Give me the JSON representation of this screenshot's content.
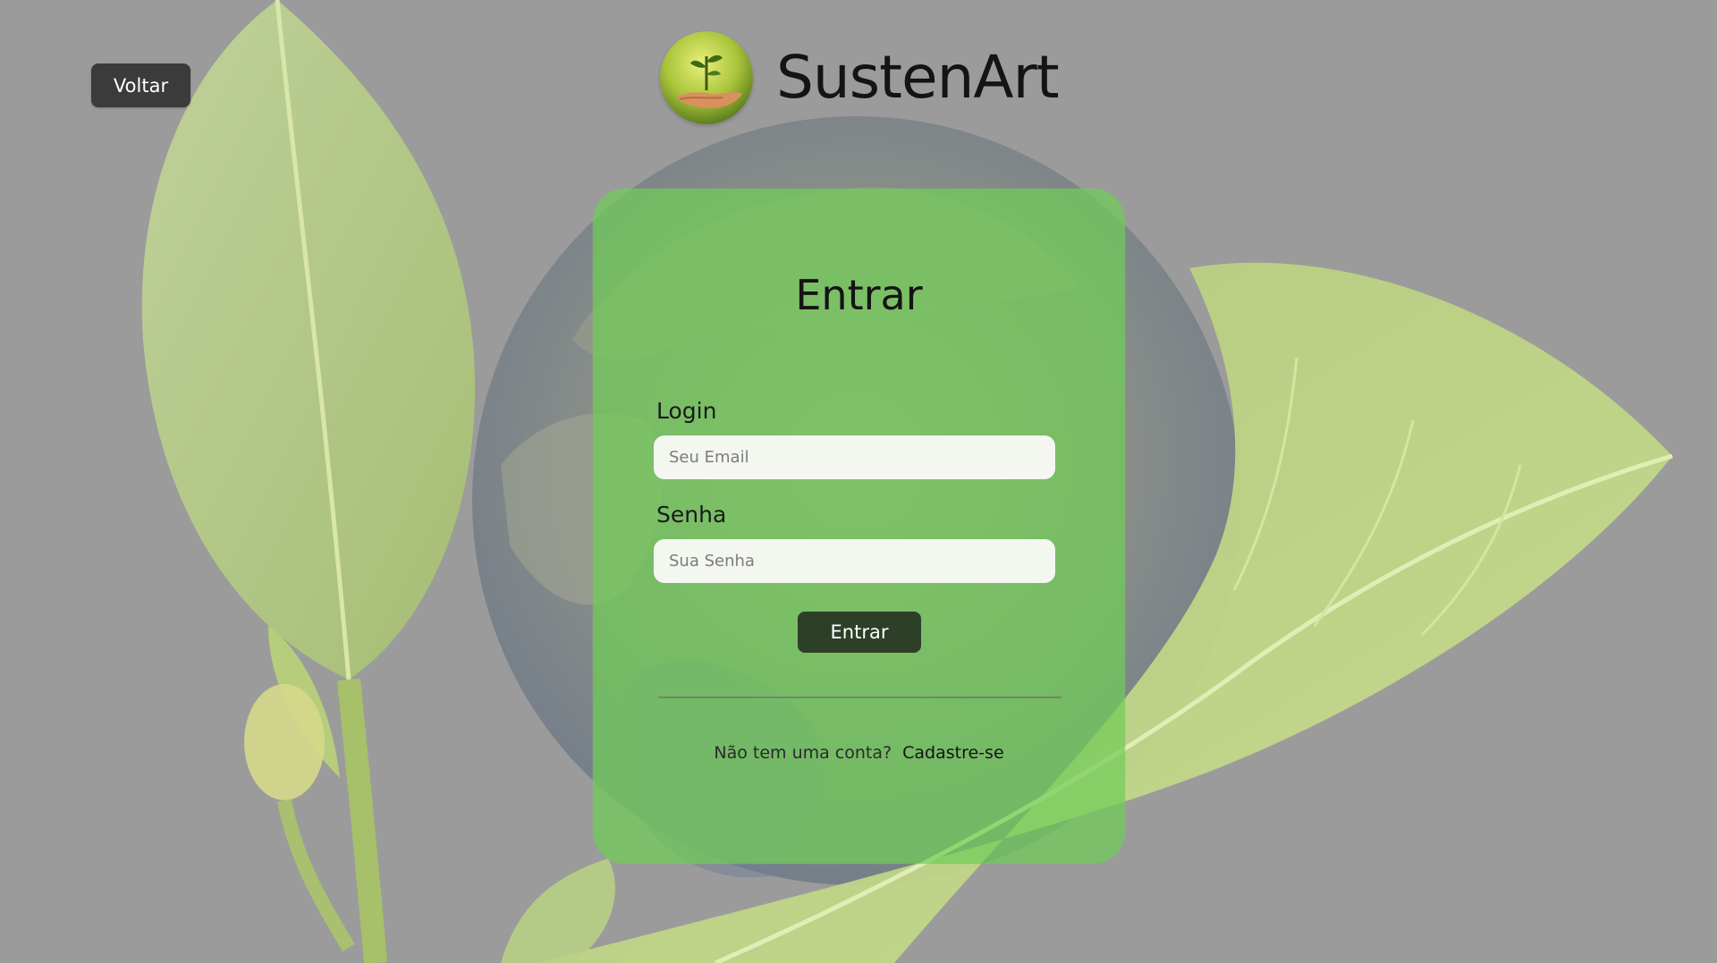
{
  "header": {
    "back_label": "Voltar",
    "brand_name": "SustenArt",
    "brand_logo_icon": "plant-in-hand-icon"
  },
  "login_card": {
    "title": "Entrar",
    "login_label": "Login",
    "email_placeholder": "Seu Email",
    "email_value": "",
    "password_label": "Senha",
    "password_placeholder": "Sua Senha",
    "password_value": "",
    "submit_label": "Entrar",
    "signup_prompt": "Não tem uma conta?",
    "signup_link": "Cadastre-se"
  },
  "colors": {
    "page_background": "#9a9a9a",
    "card_background": "#70cd58",
    "submit_button": "#2d3f27",
    "back_button": "#3b3b3b",
    "input_background": "#f3f7f0"
  }
}
